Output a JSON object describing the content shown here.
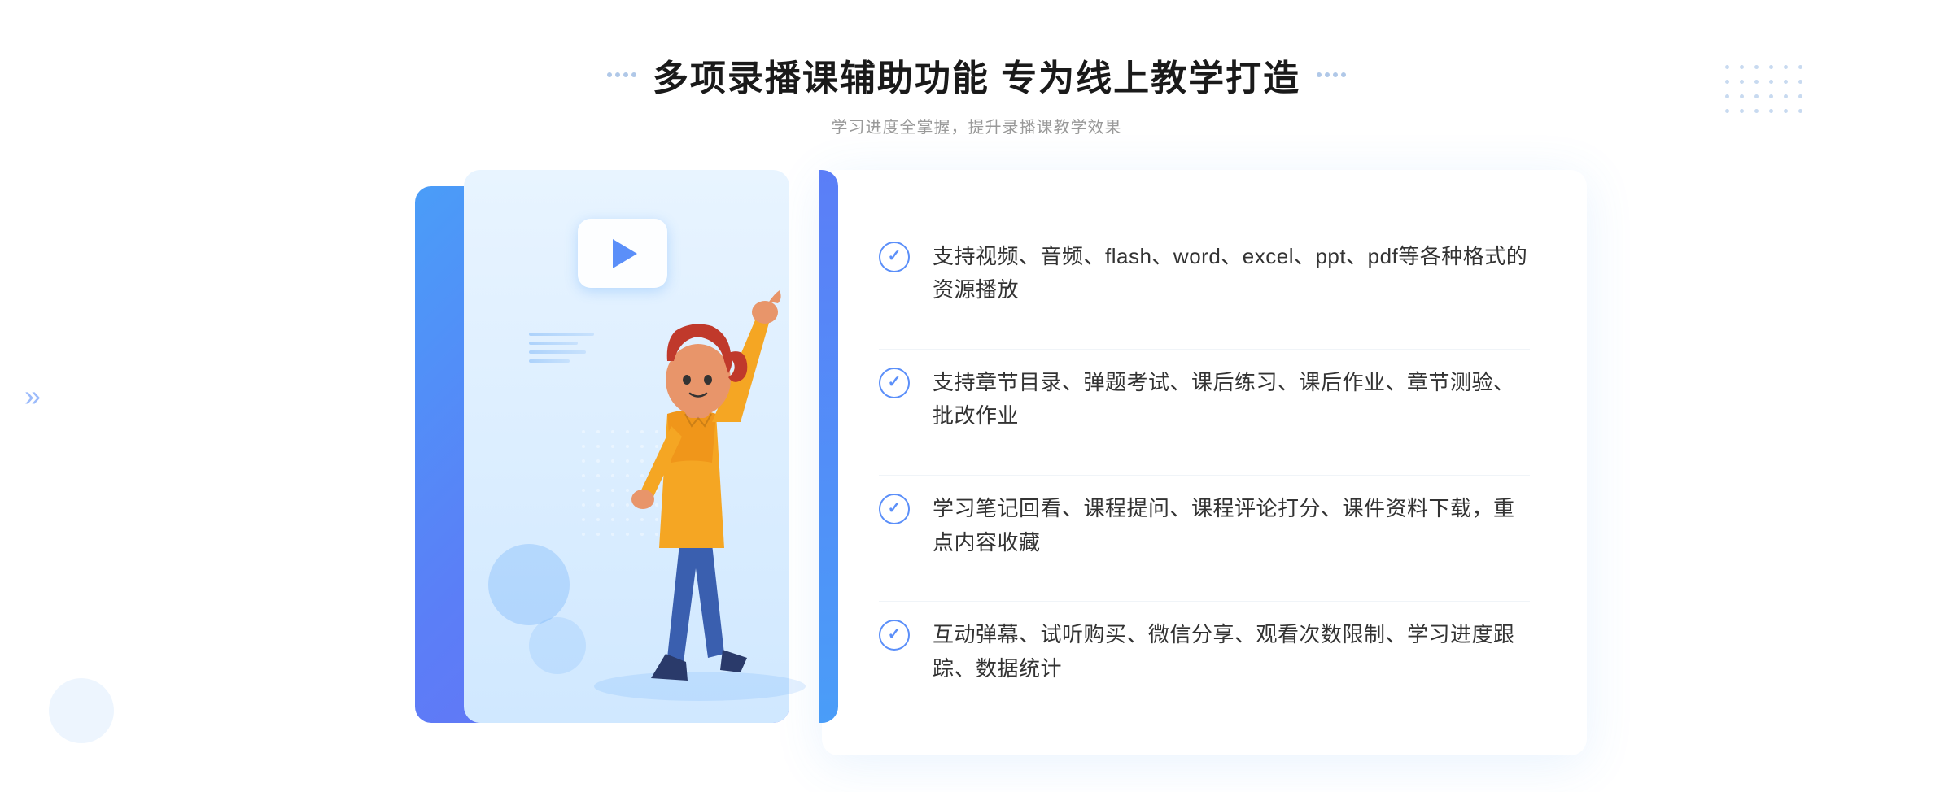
{
  "header": {
    "title": "多项录播课辅助功能 专为线上教学打造",
    "subtitle": "学习进度全掌握，提升录播课教学效果",
    "dots_left": "decorative dots left",
    "dots_right": "decorative dots right"
  },
  "features": [
    {
      "id": 1,
      "text": "支持视频、音频、flash、word、excel、ppt、pdf等各种格式的资源播放"
    },
    {
      "id": 2,
      "text": "支持章节目录、弹题考试、课后练习、课后作业、章节测验、批改作业"
    },
    {
      "id": 3,
      "text": "学习笔记回看、课程提问、课程评论打分、课件资料下载，重点内容收藏"
    },
    {
      "id": 4,
      "text": "互动弹幕、试听购买、微信分享、观看次数限制、学习进度跟踪、数据统计"
    }
  ],
  "illustration": {
    "play_icon": "▶"
  },
  "colors": {
    "blue_primary": "#5b8ff9",
    "blue_light": "#4a9df8",
    "text_dark": "#333333",
    "text_light": "#999999",
    "bg_white": "#ffffff"
  }
}
